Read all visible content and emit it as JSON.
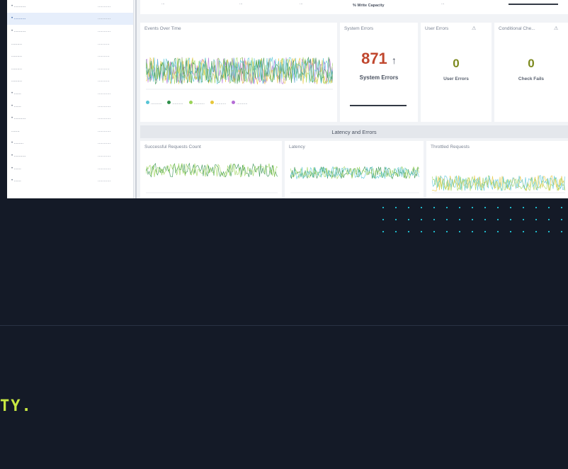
{
  "sidebar": {
    "items": [
      {
        "label": "• ..........",
        "type": "..........."
      },
      {
        "label": "• ..........",
        "type": "..........."
      },
      {
        "label": "• ..........",
        "type": "..........."
      },
      {
        "label": ".........",
        "type": ".........."
      },
      {
        "label": ".........",
        "type": ".........."
      },
      {
        "label": ".........",
        "type": ".........."
      },
      {
        "label": ".........",
        "type": ".........."
      },
      {
        "label": "• ......",
        "type": "..........."
      },
      {
        "label": "• ......",
        "type": "..........."
      },
      {
        "label": "• ..........",
        "type": "..........."
      },
      {
        "label": ".......",
        "type": "..........."
      },
      {
        "label": "• ........",
        "type": "..........."
      },
      {
        "label": "• ..........",
        "type": "..........."
      },
      {
        "label": "• ......",
        "type": "..........."
      },
      {
        "label": "• ......",
        "type": "..........."
      }
    ],
    "selected_index": 1
  },
  "top_strip": {
    "cells": [
      "...",
      "...",
      "...",
      "% Write Capacity",
      "..."
    ]
  },
  "panels": {
    "events_over_time": {
      "title": "Events Over Time"
    },
    "system_errors": {
      "title": "System Errors",
      "value": "871",
      "trend": "↑",
      "label": "System Errors"
    },
    "user_errors": {
      "title": "User Errors",
      "value": "0",
      "label": "User Errors"
    },
    "conditional_checks": {
      "title": "Conditional Che...",
      "value": "0",
      "label": "Check Fails"
    },
    "successful_requests": {
      "title": "Successful Requests Count"
    },
    "latency": {
      "title": "Latency"
    },
    "throttled_requests": {
      "title": "Throttled Requests"
    }
  },
  "section_title": "Latency and Errors",
  "legend": [
    "..........",
    "..........",
    "..........",
    "..........",
    ".........."
  ],
  "colors": {
    "error_red": "#c0472e",
    "ok_olive": "#7d8a1f",
    "accent_lime": "#c8e842",
    "dot_cyan": "#1fb7c9",
    "series": [
      "#57c4d6",
      "#2f8f4a",
      "#9bd35a",
      "#e7c63a",
      "#b56dd6"
    ]
  },
  "tagline": "TY."
}
